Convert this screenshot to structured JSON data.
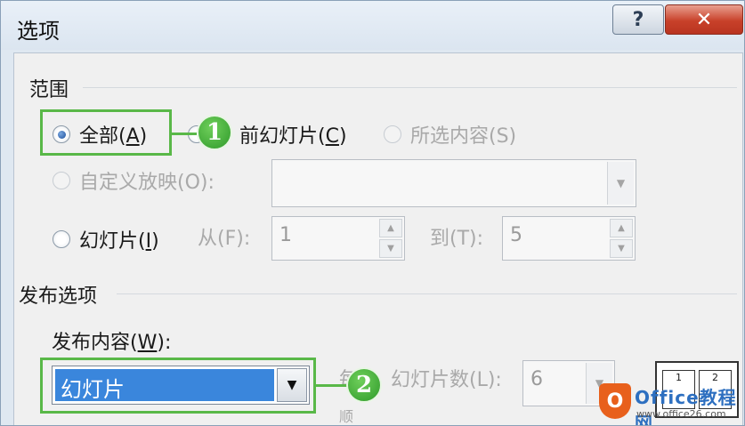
{
  "window": {
    "title": "选项"
  },
  "titlebar": {
    "help_glyph": "?",
    "close_glyph": "✕"
  },
  "range": {
    "label": "范围",
    "all": {
      "text": "全部(",
      "key": "A",
      "tail": ")"
    },
    "current": {
      "text": "前幻灯片(",
      "key": "C",
      "tail": ")"
    },
    "selection": "所选内容(S)",
    "custom_show": "自定义放映(O):",
    "slides": {
      "text": "幻灯片(",
      "key": "I",
      "tail": ")"
    },
    "from_label": "从(F):",
    "from_value": "1",
    "to_label": "到(T):",
    "to_value": "5"
  },
  "publish": {
    "label": "发布选项",
    "content_label": "发布内容(",
    "content_key": "W",
    "content_tail": "):",
    "content_value": "幻灯片",
    "slides_per_page_label": "幻灯片数(L):",
    "slides_per_page_prefix": "每",
    "slides_per_page_value": "6",
    "order_label": "顺"
  },
  "callouts": {
    "one": "1",
    "two": "2"
  },
  "layout_preview": {
    "cells": [
      "1",
      "2"
    ]
  },
  "watermark": {
    "icon": "O",
    "title": "Office教程网",
    "url": "www.office26.com"
  }
}
